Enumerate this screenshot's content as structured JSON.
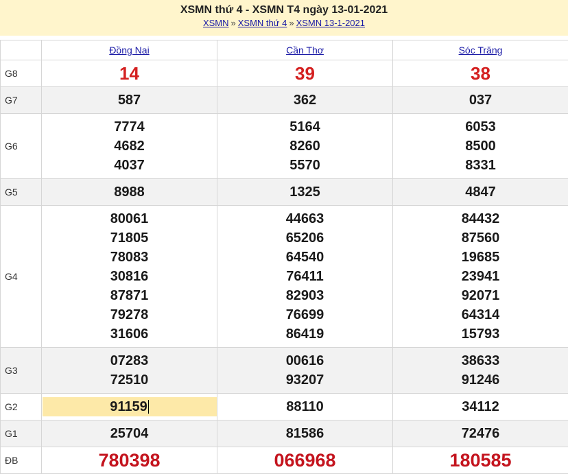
{
  "header": {
    "title": "XSMN thứ 4 - XSMN T4 ngày 13-01-2021",
    "breadcrumb": [
      "XSMN",
      "XSMN thứ 4",
      "XSMN 13-1-2021"
    ],
    "separator": "»"
  },
  "provinces": [
    "Đồng Nai",
    "Cần Thơ",
    "Sóc Trăng"
  ],
  "rows": [
    {
      "label": "G8",
      "values": [
        [
          "14"
        ],
        [
          "39"
        ],
        [
          "38"
        ]
      ]
    },
    {
      "label": "G7",
      "values": [
        [
          "587"
        ],
        [
          "362"
        ],
        [
          "037"
        ]
      ]
    },
    {
      "label": "G6",
      "values": [
        [
          "7774",
          "4682",
          "4037"
        ],
        [
          "5164",
          "8260",
          "5570"
        ],
        [
          "6053",
          "8500",
          "8331"
        ]
      ]
    },
    {
      "label": "G5",
      "values": [
        [
          "8988"
        ],
        [
          "1325"
        ],
        [
          "4847"
        ]
      ]
    },
    {
      "label": "G4",
      "values": [
        [
          "80061",
          "71805",
          "78083",
          "30816",
          "87871",
          "79278",
          "31606"
        ],
        [
          "44663",
          "65206",
          "64540",
          "76411",
          "82903",
          "76699",
          "86419"
        ],
        [
          "84432",
          "87560",
          "19685",
          "23941",
          "92071",
          "64314",
          "15793"
        ]
      ]
    },
    {
      "label": "G3",
      "values": [
        [
          "07283",
          "72510"
        ],
        [
          "00616",
          "93207"
        ],
        [
          "38633",
          "91246"
        ]
      ]
    },
    {
      "label": "G2",
      "values": [
        [
          "91159"
        ],
        [
          "88110"
        ],
        [
          "34112"
        ]
      ]
    },
    {
      "label": "G1",
      "values": [
        [
          "25704"
        ],
        [
          "81586"
        ],
        [
          "72476"
        ]
      ]
    },
    {
      "label": "ĐB",
      "values": [
        [
          "780398"
        ],
        [
          "066968"
        ],
        [
          "180585"
        ]
      ]
    }
  ],
  "colors": {
    "header_bg": "#fff5cc",
    "prize_red": "#d42020",
    "link_blue": "#1a1aa6",
    "highlight": "#fde9a8"
  }
}
